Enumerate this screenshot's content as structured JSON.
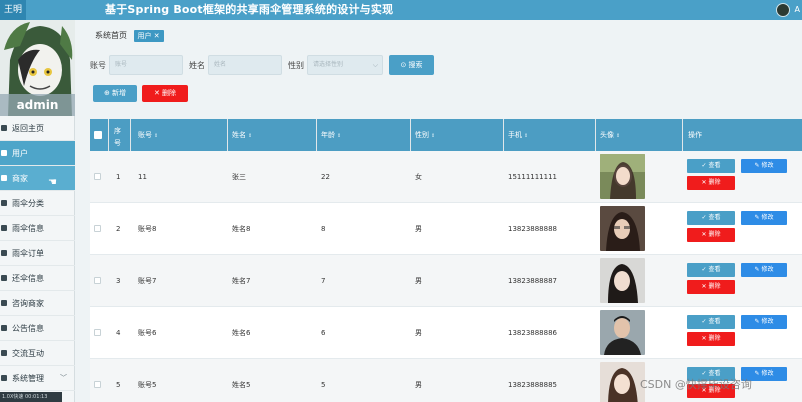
{
  "topbar": {
    "left_tag": "王明",
    "title": "基于Spring Boot框架的共享雨伞管理系统的设计与实现",
    "right_text": "A"
  },
  "sidebar": {
    "username": "admin",
    "items": [
      {
        "label": "返回主页",
        "icon": "home-icon"
      },
      {
        "label": "用户",
        "icon": "user-icon"
      },
      {
        "label": "商家",
        "icon": "grid-icon"
      },
      {
        "label": "雨伞分类",
        "icon": "tag-icon"
      },
      {
        "label": "雨伞信息",
        "icon": "umbrella-icon"
      },
      {
        "label": "雨伞订单",
        "icon": "order-icon"
      },
      {
        "label": "还伞信息",
        "icon": "location-icon"
      },
      {
        "label": "咨询商家",
        "icon": "grid-icon"
      },
      {
        "label": "公告信息",
        "icon": "grid-icon"
      },
      {
        "label": "交流互动",
        "icon": "chat-icon"
      },
      {
        "label": "系统管理",
        "icon": "settings-icon"
      }
    ],
    "bottom_bar": "1.0X快速  00:01:13"
  },
  "breadcrumb": {
    "home": "系统首页",
    "current": "用户 ✕"
  },
  "search": {
    "account_label": "账号",
    "account_placeholder": "账号",
    "name_label": "姓名",
    "name_placeholder": "姓名",
    "gender_label": "性别",
    "gender_placeholder": "请选择性别",
    "button": "搜索"
  },
  "actions": {
    "add": "新增",
    "delete": "删除"
  },
  "table": {
    "headers": [
      "序号",
      "账号",
      "姓名",
      "年龄",
      "性别",
      "手机",
      "头像",
      "操作"
    ],
    "rows": [
      {
        "no": "1",
        "account": "11",
        "name": "张三",
        "age": "22",
        "gender": "女",
        "phone": "15111111111"
      },
      {
        "no": "2",
        "account": "账号8",
        "name": "姓名8",
        "age": "8",
        "gender": "男",
        "phone": "13823888888"
      },
      {
        "no": "3",
        "account": "账号7",
        "name": "姓名7",
        "age": "7",
        "gender": "男",
        "phone": "13823888887"
      },
      {
        "no": "4",
        "account": "账号6",
        "name": "姓名6",
        "age": "6",
        "gender": "男",
        "phone": "13823888886"
      },
      {
        "no": "5",
        "account": "账号5",
        "name": "姓名5",
        "age": "5",
        "gender": "男",
        "phone": "13823888885"
      }
    ],
    "op_view": "查看",
    "op_edit": "修改",
    "op_delete": "删除"
  },
  "watermark": "CSDN @快撑毕设咨询",
  "colors": {
    "primary": "#4a9fc7",
    "danger": "#f01c1c",
    "edit": "#2e8ce6"
  }
}
